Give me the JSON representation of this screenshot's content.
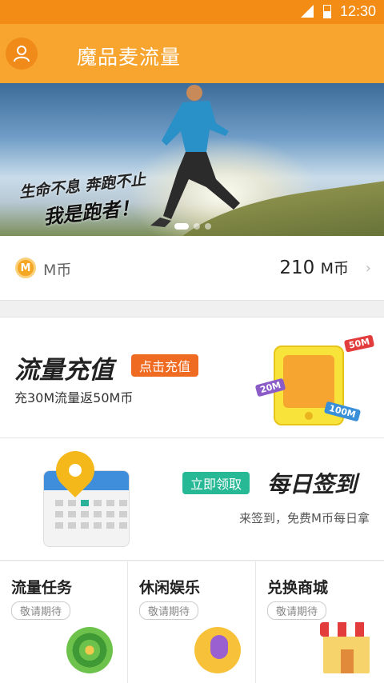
{
  "status": {
    "time": "12:30"
  },
  "header": {
    "title": "魔品麦流量"
  },
  "banner": {
    "slogan_line1": "生命不息 奔跑不止",
    "slogan_line2": "我是跑者！",
    "page_count": 3,
    "active_page": 1
  },
  "coins": {
    "icon_letter": "M",
    "label": "M币",
    "amount": "210",
    "unit": "M币"
  },
  "recharge": {
    "title": "流量充值",
    "button": "点击充值",
    "subtitle": "充30M流量返50M币",
    "tags": [
      "50M",
      "20M",
      "100M"
    ]
  },
  "signin": {
    "button": "立即领取",
    "title": "每日签到",
    "subtitle": "来签到，免费M币每日拿"
  },
  "cards": [
    {
      "title": "流量任务",
      "badge": "敬请期待",
      "icon": "target-icon"
    },
    {
      "title": "休闲娱乐",
      "badge": "敬请期待",
      "icon": "entertainment-icon"
    },
    {
      "title": "兑换商城",
      "badge": "敬请期待",
      "icon": "shop-icon"
    }
  ],
  "colors": {
    "accent": "#f7a52f",
    "status_bar": "#f28c14",
    "recharge_pill": "#f06b22",
    "signin_pill": "#27b895"
  }
}
